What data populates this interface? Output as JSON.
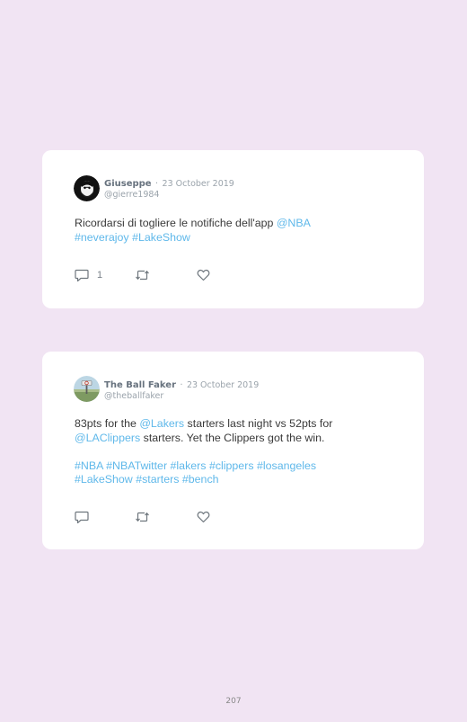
{
  "tweets": [
    {
      "name": "Giuseppe",
      "separator": "·",
      "date": "23 October 2019",
      "handle": "@gierre1984",
      "text": [
        {
          "t": "Ricordarsi di togliere le notifiche dell'app ",
          "link": false
        },
        {
          "t": "@NBA",
          "link": true
        },
        {
          "br": true
        },
        {
          "t": "#neverajoy",
          "link": true
        },
        {
          "t": " ",
          "link": false
        },
        {
          "t": "#LakeShow",
          "link": true
        }
      ],
      "reply_count": "1",
      "icons": {
        "reply": "reply-icon",
        "retweet": "retweet-icon",
        "like": "heart-icon"
      }
    },
    {
      "name": "The Ball Faker",
      "separator": "·",
      "date": "23 October 2019",
      "handle": "@theballfaker",
      "text": [
        {
          "t": "83pts for the ",
          "link": false
        },
        {
          "t": "@Lakers",
          "link": true
        },
        {
          "t": " starters last night vs 52pts for",
          "link": false
        },
        {
          "br": true
        },
        {
          "t": "@LAClippers",
          "link": true
        },
        {
          "t": " starters. Yet the Clippers got the win.",
          "link": false
        },
        {
          "br": true
        },
        {
          "br": true
        },
        {
          "t": "#NBA",
          "link": true
        },
        {
          "t": " ",
          "link": false
        },
        {
          "t": "#NBATwitter",
          "link": true
        },
        {
          "t": " ",
          "link": false
        },
        {
          "t": "#lakers",
          "link": true
        },
        {
          "t": " ",
          "link": false
        },
        {
          "t": "#clippers",
          "link": true
        },
        {
          "t": " ",
          "link": false
        },
        {
          "t": "#losangeles",
          "link": true
        },
        {
          "br": true
        },
        {
          "t": "#LakeShow",
          "link": true
        },
        {
          "t": " ",
          "link": false
        },
        {
          "t": "#starters",
          "link": true
        },
        {
          "t": " ",
          "link": false
        },
        {
          "t": "#bench",
          "link": true
        }
      ],
      "reply_count": "",
      "icons": {
        "reply": "reply-icon",
        "retweet": "retweet-icon",
        "like": "heart-icon"
      }
    }
  ],
  "page_number": "207",
  "colors": {
    "background": "#f1e4f3",
    "card": "#ffffff",
    "link": "#5fb8ea",
    "text": "#3a3a3a",
    "meta": "#9aa3ab",
    "name": "#67727e"
  }
}
